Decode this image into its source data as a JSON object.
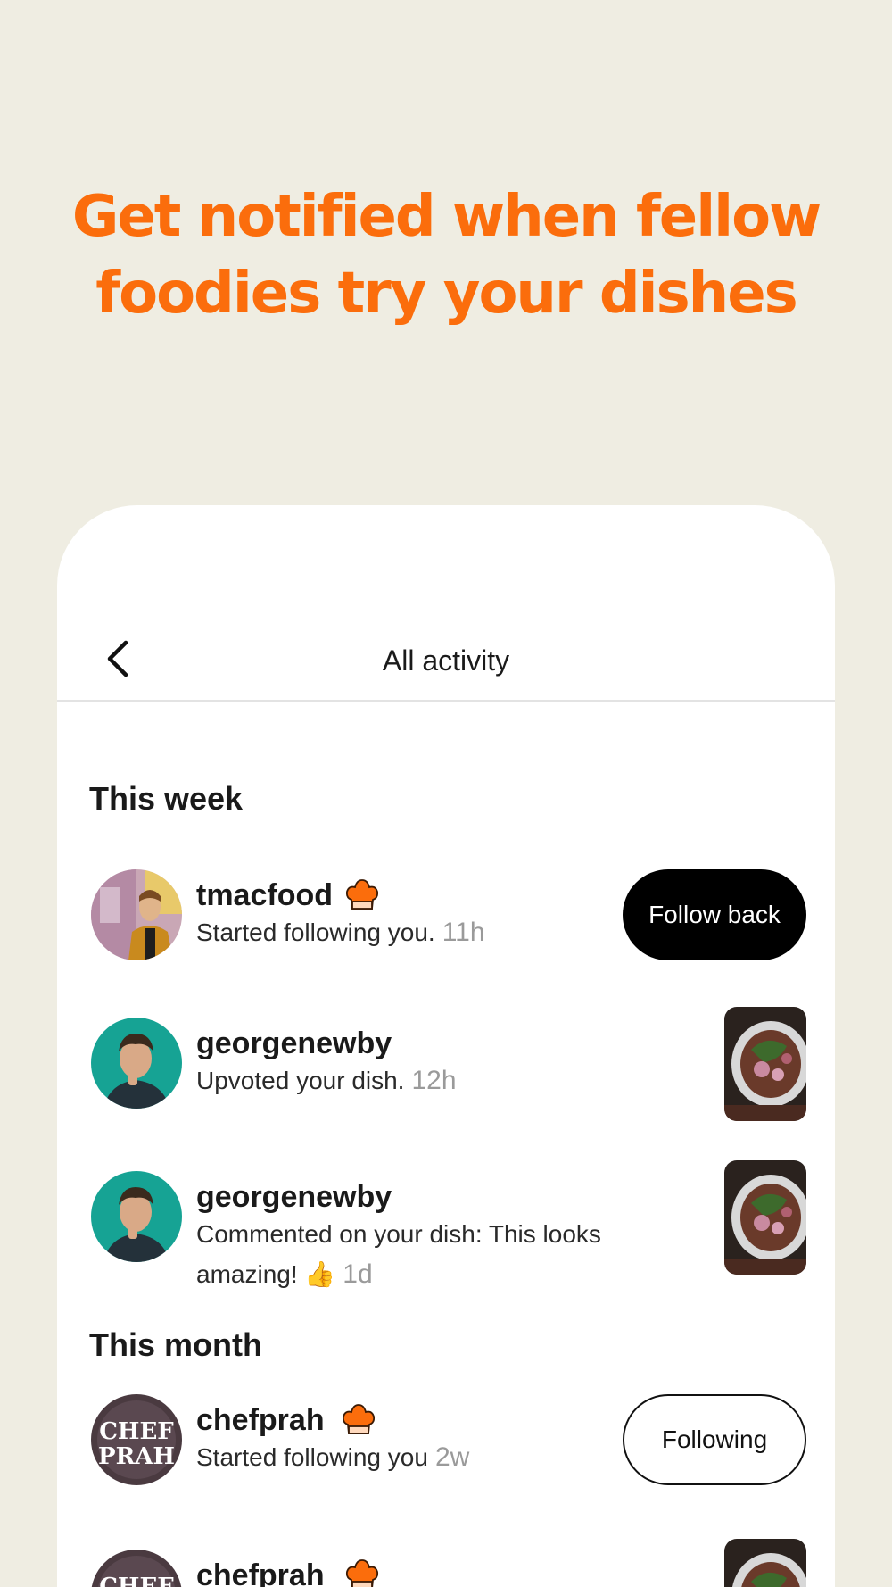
{
  "promo": {
    "headline_line1": "Get notified when fellow",
    "headline_line2": "foodies try your dishes",
    "accent_color": "#fb6d0c",
    "background_color": "#efede2"
  },
  "header": {
    "title": "All activity",
    "back_icon": "chevron-left-icon"
  },
  "sections": {
    "this_week": "This week",
    "this_month": "This month"
  },
  "activities": [
    {
      "username": "tmacfood",
      "badge": "chef-hat-icon",
      "message": "Started following you.",
      "time": "11h",
      "action": "Follow back"
    },
    {
      "username": "georgenewby",
      "message": "Upvoted your dish.",
      "time": "12h"
    },
    {
      "username": "georgenewby",
      "message_line1": "Commented on your dish: This looks",
      "message_line2": "amazing!",
      "emoji": "👍",
      "time": "1d"
    },
    {
      "username": "chefprah",
      "badge": "chef-hat-icon",
      "message": "Started following you",
      "time": "2w",
      "action": "Following",
      "avatar_text_line1": "CHEF",
      "avatar_text_line2": "PRAH"
    },
    {
      "username": "chefprah",
      "badge": "chef-hat-icon",
      "avatar_text_line1": "CHEF"
    }
  ]
}
